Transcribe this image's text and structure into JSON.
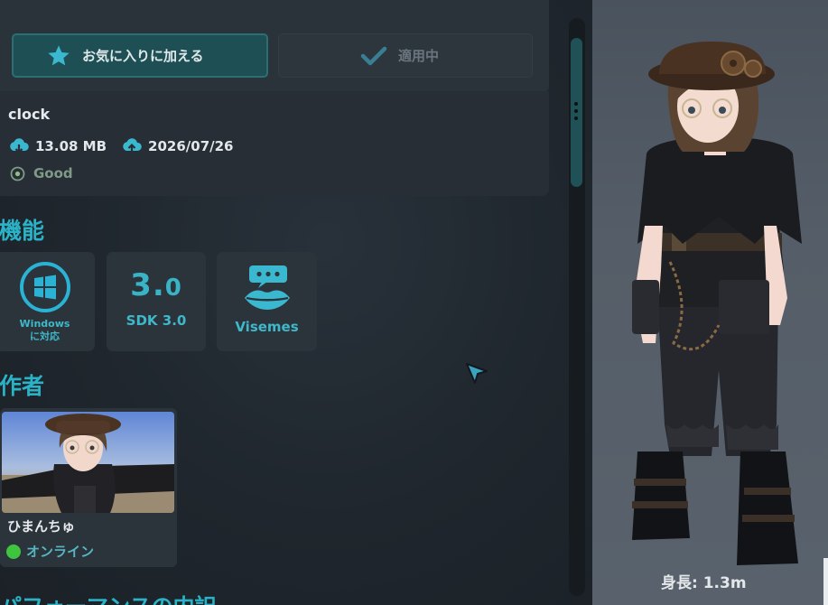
{
  "toolbar": {
    "favorite_label": "お気に入りに加える",
    "apply_label": "適用中"
  },
  "avatar_info": {
    "name": "clock",
    "file_size": "13.08 MB",
    "date": "2026/07/26",
    "performance": "Good"
  },
  "features": {
    "title": "機能",
    "items": [
      {
        "label_line1": "Windows",
        "label_line2": "に対応",
        "icon": "windows-icon"
      },
      {
        "number_main": "3.",
        "number_minor": "0",
        "label": "SDK 3.0",
        "icon": "sdk-icon"
      },
      {
        "label": "Visemes",
        "icon": "visemes-lips-icon"
      }
    ]
  },
  "author": {
    "title": "作者",
    "name": "ひまんちゅ",
    "status": "オンライン"
  },
  "performance_section": {
    "title": "パフォーマンスの内訳"
  },
  "preview": {
    "height_label": "身長: 1.3m"
  },
  "colors": {
    "accent": "#2ab3c6",
    "favorite_bg": "#1e4f55",
    "online": "#3ec43e",
    "panel": "#2b333b"
  }
}
